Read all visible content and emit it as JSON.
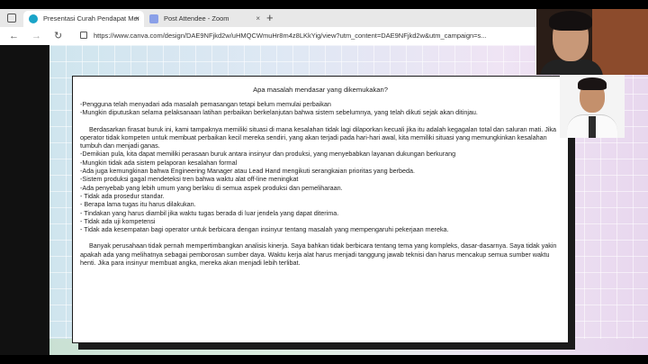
{
  "tabs": [
    {
      "label": "Presentasi Curah Pendapat Men",
      "favicon_color": "#1aa4c8"
    },
    {
      "label": "Post Attendee - Zoom",
      "favicon_color": "#8aa0e8"
    }
  ],
  "tab_close_glyph": "×",
  "new_tab_glyph": "+",
  "address": {
    "url": "https://www.canva.com/design/DAE9NFjkd2w/uHMQCWmuHr8m4z8LKkYig/view?utm_content=DAE9NFjkd2w&utm_campaign=s..."
  },
  "slide": {
    "title": "Apa masalah mendasar yang dikemukakan?",
    "paragraphs": [
      "-Pengguna telah menyadari ada masalah pemasangan tetapi belum memulai perbaikan\n-Mungkin diputuskan selama pelaksanaan latihan perbaikan berkelanjutan bahwa sistem sebelumnya, yang telah dikuti sejak akan ditinjau.",
      "Berdasarkan firasat buruk ini, kami tampaknya memiliki situasi di mana kesalahan tidak lagi dilaporkan kecuali jika itu adalah kegagalan total dan saluran mati. Jika operator tidak kompeten untuk membuat perbaikan kecil mereka sendiri, yang akan terjadi pada hari-hari awal, kita memiliki situasi yang memungkinkan kesalahan tumbuh dan menjadi ganas.\n-Demikian pula, kita dapat memiliki perasaan buruk antara insinyur dan produksi, yang menyebabkan layanan dukungan berkurang\n-Mungkin tidak ada sistem pelaporan kesalahan formal\n-Ada juga kemungkinan bahwa Engineering Manager atau Lead Hand mengikuti serangkaian prioritas yang berbeda.\n-Sistem produksi gagal mendeteksi tren bahwa waktu alat off-line meningkat\n-Ada penyebab yang lebih umum yang berlaku di semua aspek produksi dan pemeliharaan.\n- Tidak ada prosedur standar.\n- Berapa lama tugas itu harus dilakukan.\n- Tindakan yang harus diambil jika waktu tugas berada di luar jendela yang dapat diterima.\n- Tidak ada uji kompetensi\n- Tidak ada kesempatan bagi operator untuk berbicara dengan insinyur tentang masalah yang mempengaruhi pekerjaan mereka.",
      "Banyak perusahaan tidak pernah mempertimbangkan analisis kinerja. Saya bahkan tidak berbicara tentang tema yang kompleks, dasar-dasarnya. Saya tidak yakin apakah ada yang melihatnya sebagai pemborosan sumber daya. Waktu kerja alat harus menjadi tanggung jawab teknisi dan harus mencakup semua sumber waktu henti. Jika para insinyur membuat angka, mereka akan menjadi lebih terlibat."
    ]
  }
}
